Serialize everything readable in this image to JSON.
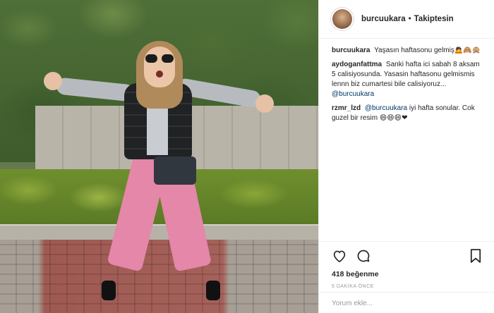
{
  "photo": {
    "alt_icon": "photo-content"
  },
  "header": {
    "username": "burcuukara",
    "separator": "•",
    "follow_status": "Takiptesin"
  },
  "comments": [
    {
      "user": "burcuukara",
      "text": "Yaşasın haftasonu gelmiş",
      "emoji": "🙇🙈🙊"
    },
    {
      "user": "aydoganfattma",
      "text": "Sanki hafta ici sabah 8 aksam 5 calisiyosunda. Yasasin haftasonu gelmismis lennn biz cumartesi bile calisiyoruz...",
      "mention": "@burcuukara"
    },
    {
      "user": "rzmr_lzd",
      "mention": "@burcuukara",
      "text": "iyi hafta sonular. Cok guzel bir resim",
      "emoji": "😄😄😄❤"
    }
  ],
  "actions": {
    "like_icon": "heart-icon",
    "comment_icon": "comment-icon",
    "bookmark_icon": "bookmark-icon"
  },
  "likes": "418 beğenme",
  "time": "5 DAKİKA ÖNCE",
  "add_comment_placeholder": "Yorum ekle..."
}
